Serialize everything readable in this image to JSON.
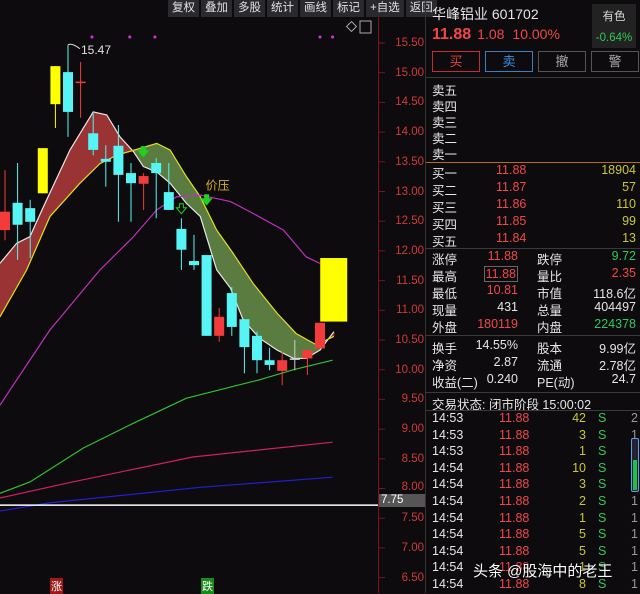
{
  "toolbar": [
    "复权",
    "叠加",
    "多股",
    "统计",
    "画线",
    "标记",
    "+自选",
    "返回"
  ],
  "axis": {
    "ticks": [
      "15.50",
      "15.00",
      "14.50",
      "14.00",
      "13.50",
      "13.00",
      "12.50",
      "12.00",
      "11.50",
      "11.00",
      "10.50",
      "10.00",
      "9.50",
      "9.00",
      "8.50",
      "8.00",
      "7.50",
      "7.00",
      "6.50"
    ],
    "current": "7.75"
  },
  "chart_data": {
    "type": "candlestick",
    "ylim": [
      6.5,
      15.5
    ],
    "candles": [
      [
        12.35,
        13.36,
        12.18,
        12.66,
        "red"
      ],
      [
        12.81,
        13.48,
        11.85,
        12.44,
        "cyan"
      ],
      [
        12.72,
        12.86,
        11.88,
        12.49,
        "cyan"
      ],
      [
        12.97,
        13.73,
        12.97,
        13.73,
        "yellow"
      ],
      [
        14.47,
        15.11,
        14.07,
        15.11,
        "yellow"
      ],
      [
        15.01,
        15.47,
        13.92,
        14.34,
        "cyan"
      ],
      [
        14.83,
        15.18,
        14.24,
        14.85,
        "red"
      ],
      [
        13.98,
        14.32,
        13.61,
        13.7,
        "cyan"
      ],
      [
        13.55,
        13.78,
        13.08,
        13.5,
        "cyan"
      ],
      [
        13.77,
        14.12,
        12.49,
        13.28,
        "cyan"
      ],
      [
        13.31,
        13.48,
        12.49,
        13.14,
        "cyan"
      ],
      [
        13.13,
        13.31,
        12.69,
        13.26,
        "red"
      ],
      [
        13.48,
        13.56,
        12.55,
        13.31,
        "cyan"
      ],
      [
        12.99,
        13.48,
        12.69,
        12.69,
        "cyan"
      ],
      [
        12.37,
        12.55,
        11.68,
        12.02,
        "cyan"
      ],
      [
        11.83,
        12.27,
        11.68,
        11.76,
        "cyan"
      ],
      [
        11.93,
        11.93,
        10.57,
        10.57,
        "cyan"
      ],
      [
        10.57,
        11.04,
        10.47,
        10.89,
        "red"
      ],
      [
        11.29,
        11.39,
        10.57,
        10.72,
        "cyan"
      ],
      [
        10.85,
        10.85,
        9.94,
        10.38,
        "cyan"
      ],
      [
        10.57,
        10.64,
        9.94,
        10.16,
        "cyan"
      ],
      [
        10.16,
        10.37,
        9.99,
        10.08,
        "cyan"
      ],
      [
        9.98,
        10.3,
        9.74,
        10.16,
        "red"
      ],
      [
        10.19,
        10.5,
        9.99,
        10.19,
        "gray"
      ],
      [
        10.19,
        10.33,
        9.91,
        10.33,
        "red"
      ],
      [
        10.36,
        10.79,
        10.36,
        10.79,
        "red"
      ]
    ],
    "signal_box": {
      "idx": 26.05,
      "low": 10.81,
      "high": 11.88
    },
    "high_label": {
      "idx": 5,
      "value": "15.47"
    },
    "ribbon_fast": [
      [
        -0.4,
        11.79
      ],
      [
        0.93,
        12.13
      ],
      [
        1.98,
        12.24
      ],
      [
        3.04,
        12.74
      ],
      [
        5.16,
        13.7
      ],
      [
        7,
        14.34
      ],
      [
        8.07,
        14.29
      ],
      [
        9.13,
        13.92
      ],
      [
        10.2,
        13.67
      ],
      [
        10.98,
        13.42
      ],
      [
        12.04,
        13.33
      ],
      [
        13.1,
        13.14
      ],
      [
        14.4,
        12.8
      ],
      [
        15.5,
        12.58
      ],
      [
        16.8,
        11.68
      ],
      [
        17.9,
        11.37
      ],
      [
        18.9,
        10.84
      ],
      [
        20.2,
        10.53
      ],
      [
        21.6,
        10.33
      ],
      [
        22.9,
        10.19
      ],
      [
        23.9,
        10.19
      ],
      [
        25,
        10.33
      ],
      [
        26.1,
        10.64
      ]
    ],
    "ribbon_slow": [
      [
        -0.4,
        10.89
      ],
      [
        1.72,
        11.68
      ],
      [
        3.57,
        12.58
      ],
      [
        5.95,
        13.14
      ],
      [
        7.54,
        13.47
      ],
      [
        8.86,
        13.61
      ],
      [
        12.04,
        13.81
      ],
      [
        13.1,
        13.7
      ],
      [
        14.4,
        13.25
      ],
      [
        15.5,
        12.91
      ],
      [
        16.8,
        12.35
      ],
      [
        18.1,
        11.96
      ],
      [
        19.7,
        11.45
      ],
      [
        21.6,
        10.95
      ],
      [
        23.1,
        10.61
      ],
      [
        24.7,
        10.42
      ],
      [
        26.1,
        10.56
      ]
    ],
    "lines": [
      {
        "color": "#c030c0",
        "points": [
          [
            -0.4,
            9.4
          ],
          [
            0.4,
            9.66
          ],
          [
            3.57,
            10.67
          ],
          [
            7.54,
            11.68
          ],
          [
            10.2,
            12.24
          ],
          [
            12.04,
            12.69
          ],
          [
            13.6,
            12.91
          ],
          [
            15.5,
            12.94
          ],
          [
            17.9,
            12.83
          ],
          [
            19.7,
            12.63
          ],
          [
            22.1,
            12.35
          ],
          [
            23.9,
            11.9
          ],
          [
            25,
            11.79
          ]
        ]
      },
      {
        "color": "#30c030",
        "points": [
          [
            -0.4,
            7.92
          ],
          [
            1.98,
            8.11
          ],
          [
            6.2,
            8.68
          ],
          [
            10.2,
            9.1
          ],
          [
            14.4,
            9.52
          ],
          [
            20.2,
            9.83
          ],
          [
            22.9,
            10.0
          ],
          [
            26,
            10.16
          ]
        ]
      },
      {
        "color": "#d02060",
        "points": [
          [
            -0.4,
            7.84
          ],
          [
            4.9,
            8.09
          ],
          [
            14.9,
            8.53
          ],
          [
            26,
            8.78
          ]
        ]
      },
      {
        "color": "#2020d0",
        "points": [
          [
            -0.4,
            7.62
          ],
          [
            3.57,
            7.76
          ],
          [
            15.5,
            8.02
          ],
          [
            26,
            8.19
          ]
        ]
      }
    ],
    "ref_line": 7.72,
    "arrows": [
      [
        10.98,
        13.62,
        "solid"
      ],
      [
        14,
        12.66,
        "hollow"
      ],
      [
        16,
        12.81,
        "solid"
      ]
    ],
    "annotation": {
      "idx": 16,
      "price": 13.0,
      "text": "价压"
    },
    "dots": [
      6.9,
      9.9,
      11.9,
      25,
      26
    ]
  },
  "tags": {
    "up": "涨",
    "down": "跌"
  },
  "stock": {
    "name": "华峰铝业 601702",
    "price": "11.88",
    "change": "1.08",
    "pct": "10.00%",
    "sector": "有色",
    "sector_pct": "-0.64%"
  },
  "buttons": [
    "买",
    "卖",
    "撤",
    "警"
  ],
  "asks": [
    "卖五",
    "卖四",
    "卖三",
    "卖二",
    "卖一"
  ],
  "bids": [
    [
      "买一",
      "11.88",
      "18904"
    ],
    [
      "买二",
      "11.87",
      "57"
    ],
    [
      "买三",
      "11.86",
      "110"
    ],
    [
      "买四",
      "11.85",
      "99"
    ],
    [
      "买五",
      "11.84",
      "13"
    ]
  ],
  "stats1": [
    [
      "涨停",
      "11.88",
      "跌停",
      "9.72"
    ],
    [
      "最高",
      "11.88",
      "量比",
      "2.35"
    ],
    [
      "最低",
      "10.81",
      "市值",
      "118.6亿"
    ],
    [
      "现量",
      "431",
      "总量",
      "404497"
    ],
    [
      "外盘",
      "180119",
      "内盘",
      "224378"
    ]
  ],
  "stats2": [
    [
      "换手",
      "14.55%",
      "股本",
      "9.99亿"
    ],
    [
      "净资",
      "2.87",
      "流通",
      "2.78亿"
    ],
    [
      "收益(二)",
      "0.240",
      "PE(动)",
      "24.7"
    ]
  ],
  "status": "交易状态: 闭市阶段 15:00:02",
  "ticks": [
    [
      "14:53",
      "11.88",
      "42",
      "S",
      "2"
    ],
    [
      "14:53",
      "11.88",
      "3",
      "S",
      "1"
    ],
    [
      "14:53",
      "11.88",
      "1",
      "S",
      ""
    ],
    [
      "14:54",
      "11.88",
      "10",
      "S",
      ""
    ],
    [
      "14:54",
      "11.88",
      "3",
      "S",
      ""
    ],
    [
      "14:54",
      "11.88",
      "2",
      "S",
      "1"
    ],
    [
      "14:54",
      "11.88",
      "1",
      "S",
      "1"
    ],
    [
      "14:54",
      "11.88",
      "5",
      "S",
      "1"
    ],
    [
      "14:54",
      "11.88",
      "5",
      "S",
      "1"
    ],
    [
      "14:54",
      "11.88",
      "1",
      "S",
      "1"
    ],
    [
      "14:54",
      "11.88",
      "8",
      "S",
      "1"
    ]
  ],
  "watermark": "头条 @股海中的老王"
}
